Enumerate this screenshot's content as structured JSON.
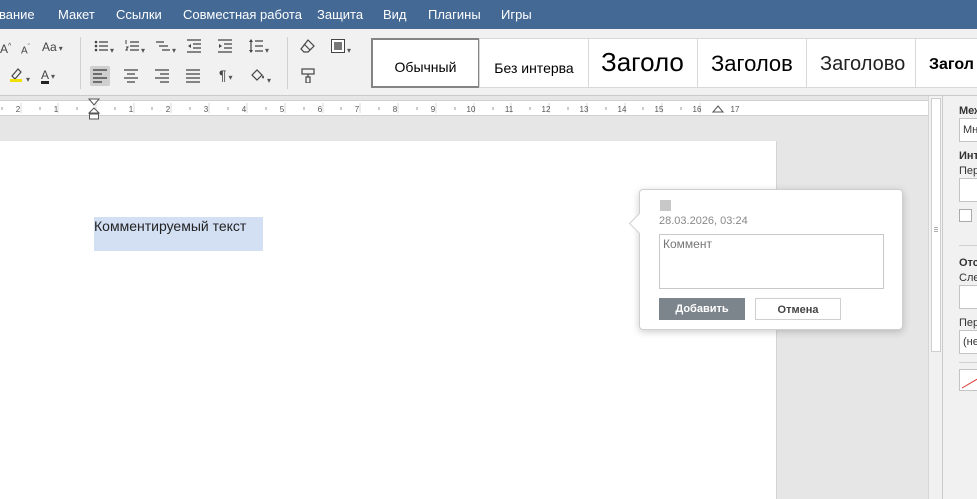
{
  "menubar": {
    "items": [
      "вание",
      "Макет",
      "Ссылки",
      "Совместная работа",
      "Защита",
      "Вид",
      "Плагины",
      "Игры"
    ]
  },
  "toolbar": {
    "font_grow": "A",
    "font_shrink": "A",
    "change_case": "Aa",
    "font_color_letter": "A",
    "paragraph_mark": "¶"
  },
  "styles": {
    "items": [
      "Обычный",
      "Без интерва",
      "Заголо",
      "Заголов",
      "Заголово",
      "Загол"
    ],
    "selected": "Обычный"
  },
  "ruler": {
    "numbers": [
      "2",
      "1",
      "1",
      "2",
      "3",
      "4",
      "5",
      "6",
      "7",
      "8",
      "9",
      "10",
      "11",
      "12",
      "13",
      "14",
      "15",
      "16",
      "17"
    ]
  },
  "document": {
    "selected_text": "Комментируемый текст"
  },
  "comment_popup": {
    "timestamp": "28.03.2026, 03:24",
    "placeholder": "Коммент",
    "add_label": "Добавить",
    "cancel_label": "Отмена"
  },
  "right_panel": {
    "label_1": "Меж",
    "field_1": "Мн",
    "label_2": "Инт",
    "label_3": "Пер",
    "label_4": "Отс",
    "label_5": "Сле",
    "label_6": "Пер",
    "field_2": "(не"
  },
  "colors": {
    "menubar": "#446995",
    "highlight": "#d3e0f4",
    "highlighter_yellow": "#f0e000",
    "add_button": "#7d858c"
  }
}
